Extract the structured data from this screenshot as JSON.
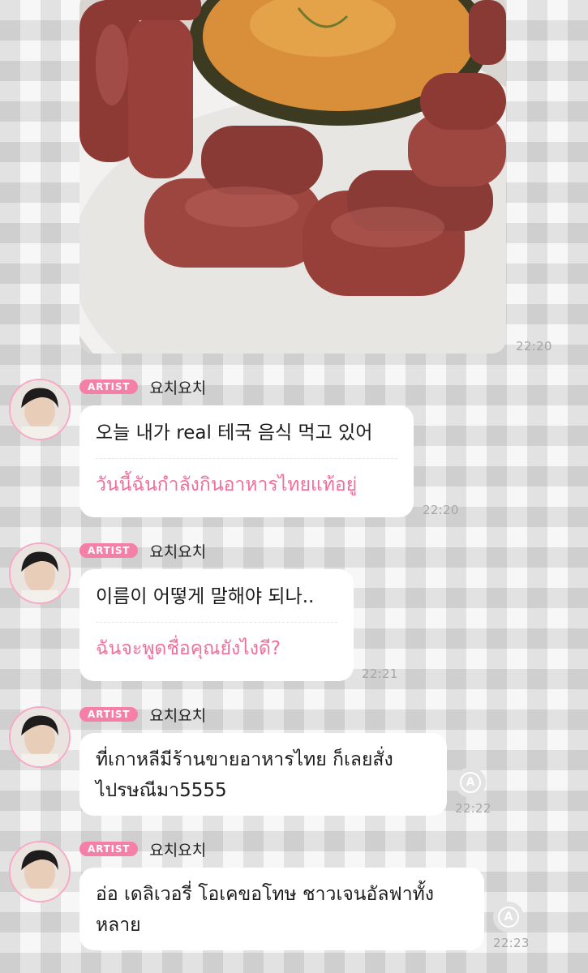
{
  "photo_message": {
    "time": "22:20",
    "alt_icon": "food-photo"
  },
  "messages": [
    {
      "badge": "ARTIST",
      "sender": "요치요치",
      "original": "오늘 내가 real 테국 음식 먹고 있어",
      "translation": "วันนี้ฉันกำลังกินอาหารไทยแท้อยู่",
      "time": "22:20"
    },
    {
      "badge": "ARTIST",
      "sender": "요치요치",
      "original": "이름이 어떻게 말해야 되나..",
      "translation": "ฉันจะพูดชื่อคุณยังไงดี?",
      "time": "22:21"
    },
    {
      "badge": "ARTIST",
      "sender": "요치요치",
      "original_line1": "ที่เกาหลีมีร้านขายอาหารไทย ก็เลยสั่ง",
      "original_line2": "ไปรษณีมา5555",
      "time": "22:22",
      "translate_icon": "A"
    },
    {
      "badge": "ARTIST",
      "sender": "요치요치",
      "original_line1": "อ่อ เดลิเวอรี่ โอเคขอโทษ ชาวเจนอัลฟาทั้ง",
      "original_line2": "หลาย",
      "time": "22:23",
      "translate_icon": "A"
    }
  ]
}
